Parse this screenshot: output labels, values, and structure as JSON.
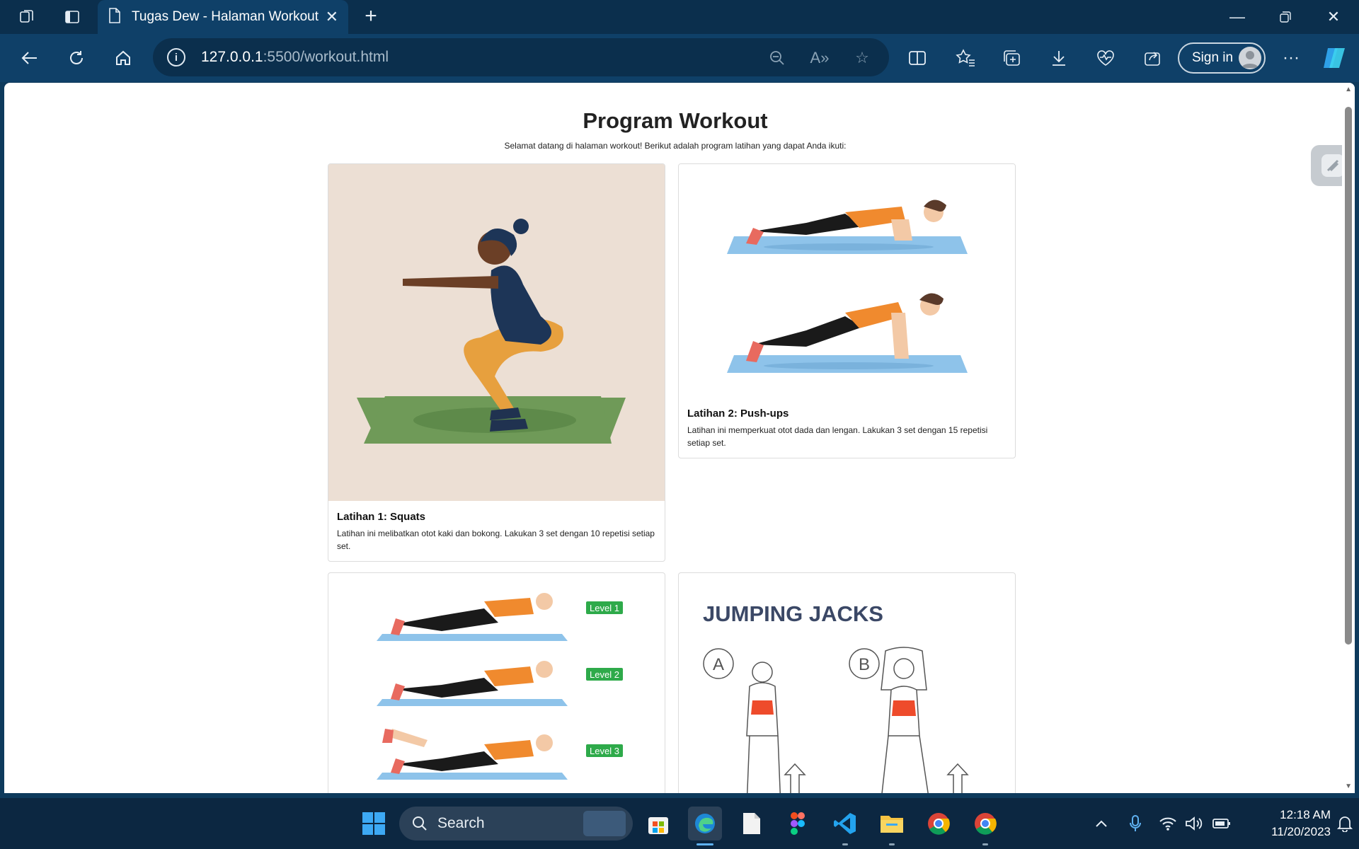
{
  "browser": {
    "tab_title": "Tugas Dew - Halaman Workout",
    "url_host": "127.0.0.1",
    "url_path": ":5500/workout.html",
    "sign_in_label": "Sign in"
  },
  "page": {
    "title": "Program Workout",
    "subtitle": "Selamat datang di halaman workout! Berikut adalah program latihan yang dapat Anda ikuti:",
    "cards": [
      {
        "title": "Latihan 1: Squats",
        "desc": "Latihan ini melibatkan otot kaki dan bokong. Lakukan 3 set dengan 10 repetisi setiap set."
      },
      {
        "title": "Latihan 2: Push-ups",
        "desc": "Latihan ini memperkuat otot dada dan lengan. Lakukan 3 set dengan 15 repetisi setiap set."
      }
    ],
    "plank_levels": [
      "Level 1",
      "Level 2",
      "Level 3"
    ],
    "jumping_title": "JUMPING JACKS",
    "jumping_labels": [
      "A",
      "B"
    ]
  },
  "taskbar": {
    "search_label": "Search",
    "time": "12:18 AM",
    "date": "11/20/2023"
  },
  "colors": {
    "accent": "#0f4068",
    "level_badge": "#2eaa4a",
    "mat_blue": "#8ec3ea",
    "mat_green": "#6f9a58"
  }
}
